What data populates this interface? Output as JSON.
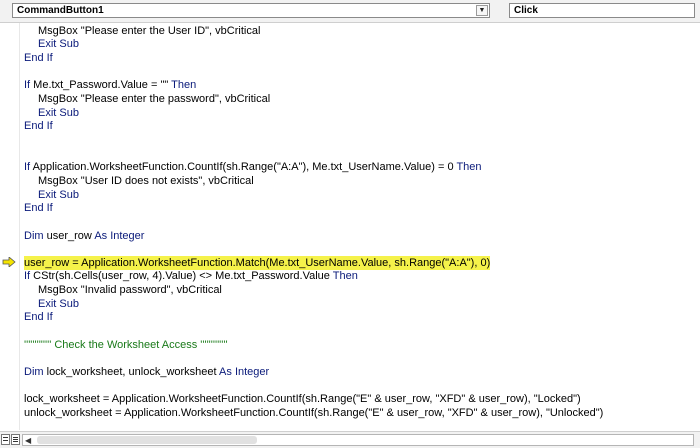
{
  "header": {
    "object_select": "CommandButton1",
    "procedure_select": "Click",
    "dropdown_glyph": "▼"
  },
  "code": {
    "l01": "MsgBox \"Please enter the User ID\", vbCritical",
    "l02": "Exit Sub",
    "l03": "End If",
    "l04a": "If",
    "l04b": " Me.txt_Password.Value = \"\" ",
    "l04c": "Then",
    "l05": "MsgBox \"Please enter the password\", vbCritical",
    "l06": "Exit Sub",
    "l07": "End If",
    "l08a": "If",
    "l08b": " Application.WorksheetFunction.CountIf(sh.Range(\"A:A\"), Me.txt_UserName.Value) = 0 ",
    "l08c": "Then",
    "l09": "MsgBox \"User ID does not exists\", vbCritical",
    "l10": "Exit Sub",
    "l11": "End If",
    "l12a": "Dim",
    "l12b": " user_row ",
    "l12c": "As Integer",
    "l13": "user_row = Application.WorksheetFunction.Match(Me.txt_UserName.Value, sh.Range(\"A:A\"), 0)",
    "l14a": "If",
    "l14b": " CStr(sh.Cells(user_row, 4).Value) <> Me.txt_Password.Value ",
    "l14c": "Then",
    "l15": "MsgBox \"Invalid password\", vbCritical",
    "l16": "Exit Sub",
    "l17": "End If",
    "l18": "''''''''''''' Check the Worksheet Access '''''''''''''",
    "l19a": "Dim",
    "l19b": " lock_worksheet, unlock_worksheet ",
    "l19c": "As Integer",
    "l20": "lock_worksheet = Application.WorksheetFunction.CountIf(sh.Range(\"E\" & user_row, \"XFD\" & user_row), \"Locked\")",
    "l21": "unlock_worksheet = Application.WorksheetFunction.CountIf(sh.Range(\"E\" & user_row, \"XFD\" & user_row), \"Unlocked\")"
  },
  "colors": {
    "keyword": "#0a1a7a",
    "comment": "#197a19",
    "highlight": "#f5f24a",
    "execution_arrow": "#f5e400"
  },
  "icons": {
    "execution_pointer": "execution-arrow-icon",
    "procedure_view": "procedure-view-icon",
    "full_module_view": "full-module-view-icon",
    "scroll_left": "scroll-left-icon"
  },
  "scroll_left_glyph": "◀"
}
